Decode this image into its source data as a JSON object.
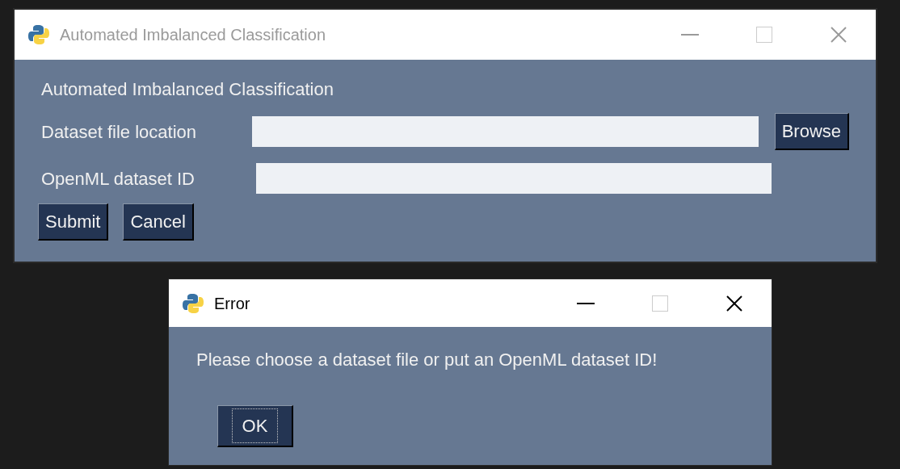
{
  "main_window": {
    "title": "Automated Imbalanced Classification",
    "active": false,
    "heading": "Automated Imbalanced Classification",
    "fields": [
      {
        "label": "Dataset file location",
        "button": "Browse"
      },
      {
        "label": "OpenML dataset ID"
      }
    ],
    "buttons": [
      "Submit",
      "Cancel"
    ]
  },
  "error_dialog": {
    "title": "Error",
    "active": true,
    "message": "Please choose a dataset file or put an OpenML dataset ID!",
    "button": {
      "label": "OK",
      "focused": true
    }
  }
}
